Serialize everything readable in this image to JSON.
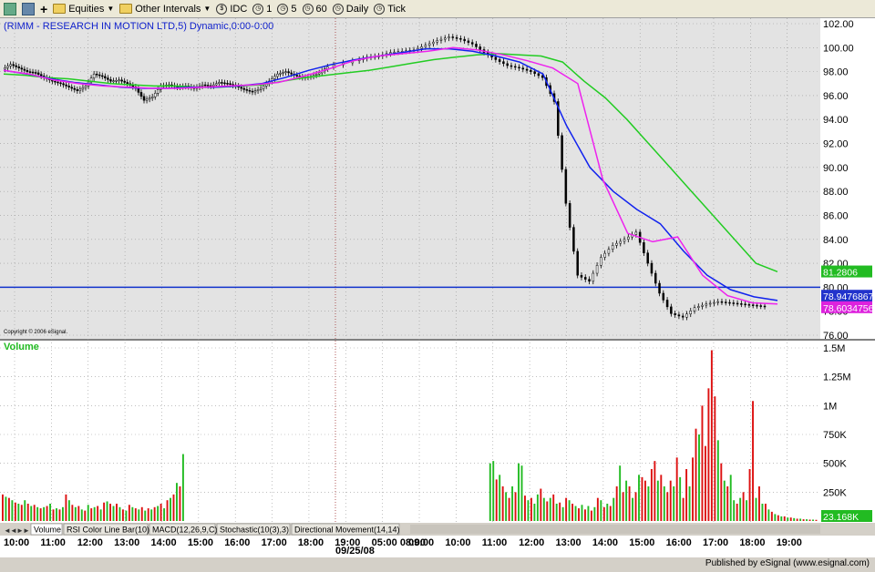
{
  "toolbar": {
    "items": [
      "Equities",
      "Other Intervals",
      "IDC",
      "1",
      "5",
      "60",
      "Daily",
      "Tick"
    ]
  },
  "chart_data": {
    "type": "candlestick",
    "title": "(RIMM - RESEARCH IN MOTION LTD,5) Dynamic,0:00-0:00",
    "copyright": "Copyright © 2006 eSignal.",
    "price_axis": {
      "ylim": [
        76,
        102
      ],
      "ticks": [
        "102.00",
        "100.00",
        "98.00",
        "96.00",
        "94.00",
        "92.00",
        "90.00",
        "88.00",
        "86.00",
        "84.00",
        "82.00",
        "80.00",
        "78.00",
        "76.00"
      ]
    },
    "time_ticks": [
      "10:00",
      "11:00",
      "12:00",
      "13:00",
      "14:00",
      "15:00",
      "16:00",
      "17:00",
      "18:00",
      "19:00",
      "05:00 08:00",
      "09:00",
      "10:00",
      "11:00",
      "12:00",
      "13:00",
      "14:00",
      "15:00",
      "16:00",
      "17:00",
      "18:00",
      "19:00"
    ],
    "date_label": "09/25/08",
    "horizontal_line": 80.0,
    "price_badges": [
      {
        "text": "81.2806",
        "color": "#22bb22"
      },
      {
        "text": "78.9476867",
        "color": "#2233cc"
      },
      {
        "text": "78.6034756",
        "color": "#dd22dd"
      }
    ],
    "price_path": [
      98.2,
      98.6,
      98.3,
      98.0,
      97.9,
      97.5,
      97.2,
      97.0,
      96.7,
      96.4,
      96.8,
      97.8,
      97.6,
      97.2,
      97.3,
      97.0,
      96.6,
      95.6,
      95.9,
      96.8,
      96.9,
      96.7,
      96.8,
      96.6,
      96.9,
      96.8,
      97.1,
      97.0,
      96.8,
      96.5,
      96.3,
      96.6,
      97.2,
      97.8,
      98.0,
      97.7,
      97.5,
      97.6,
      97.9,
      98.4,
      98.9,
      99.2,
      99.3,
      99.6,
      99.7,
      99.8,
      100.2,
      100.6,
      100.9,
      100.7,
      100.3,
      99.6,
      99.0,
      98.5,
      98.3,
      98.0,
      97.5,
      95.5,
      87.0,
      81.0,
      80.5,
      82.5,
      83.5,
      84.0,
      84.6,
      82.0,
      79.5,
      77.8,
      77.5,
      78.3,
      78.6,
      78.8,
      78.7,
      78.6,
      78.5,
      78.4
    ],
    "green_ma": [
      97.8,
      97.7,
      97.5,
      97.4,
      97.2,
      97.0,
      96.9,
      96.8,
      96.8,
      96.7,
      96.7,
      96.8,
      96.9,
      97.2,
      97.5,
      97.7,
      97.9,
      98.1,
      98.4,
      98.7,
      99.0,
      99.2,
      99.4,
      99.5,
      99.4,
      99.3,
      98.8,
      97.2,
      95.8,
      94.0,
      92.0,
      90.0,
      88.0,
      86.0,
      84.0,
      82.0,
      81.3
    ],
    "blue_ma": [
      98.1,
      97.8,
      97.4,
      97.1,
      96.9,
      96.7,
      96.6,
      96.6,
      96.7,
      96.7,
      96.8,
      97.0,
      97.5,
      98.1,
      98.6,
      99.0,
      99.3,
      99.6,
      99.9,
      99.9,
      99.7,
      99.3,
      98.8,
      97.8,
      93.5,
      90.0,
      88.0,
      86.5,
      85.3,
      83.0,
      81.0,
      79.8,
      79.2,
      78.9
    ],
    "magenta_ma": [
      98.1,
      97.8,
      97.3,
      97.0,
      96.8,
      96.7,
      96.6,
      96.6,
      96.7,
      96.8,
      96.9,
      97.1,
      97.6,
      98.2,
      98.9,
      99.3,
      99.5,
      99.7,
      100.0,
      99.8,
      99.4,
      98.9,
      98.3,
      97.0,
      89.0,
      84.5,
      83.8,
      84.2,
      81.0,
      79.3,
      78.7,
      78.6
    ],
    "volume_axis": {
      "ylim": [
        0,
        1500
      ],
      "ticks": [
        "1.5M",
        "1.25M",
        "1M",
        "750K",
        "500K",
        "250K"
      ]
    },
    "volume_label": "Volume",
    "volume_badge": "23.168K",
    "volume": [
      {
        "v": 230,
        "c": "r"
      },
      {
        "v": 210,
        "c": "g"
      },
      {
        "v": 200,
        "c": "r"
      },
      {
        "v": 180,
        "c": "g"
      },
      {
        "v": 160,
        "c": "r"
      },
      {
        "v": 150,
        "c": "g"
      },
      {
        "v": 140,
        "c": "r"
      },
      {
        "v": 180,
        "c": "g"
      },
      {
        "v": 150,
        "c": "r"
      },
      {
        "v": 130,
        "c": "g"
      },
      {
        "v": 140,
        "c": "r"
      },
      {
        "v": 120,
        "c": "g"
      },
      {
        "v": 110,
        "c": "r"
      },
      {
        "v": 120,
        "c": "g"
      },
      {
        "v": 130,
        "c": "r"
      },
      {
        "v": 150,
        "c": "g"
      },
      {
        "v": 100,
        "c": "r"
      },
      {
        "v": 110,
        "c": "g"
      },
      {
        "v": 100,
        "c": "r"
      },
      {
        "v": 120,
        "c": "g"
      },
      {
        "v": 230,
        "c": "r"
      },
      {
        "v": 180,
        "c": "g"
      },
      {
        "v": 140,
        "c": "r"
      },
      {
        "v": 120,
        "c": "g"
      },
      {
        "v": 130,
        "c": "r"
      },
      {
        "v": 100,
        "c": "g"
      },
      {
        "v": 90,
        "c": "r"
      },
      {
        "v": 140,
        "c": "g"
      },
      {
        "v": 110,
        "c": "r"
      },
      {
        "v": 120,
        "c": "g"
      },
      {
        "v": 130,
        "c": "r"
      },
      {
        "v": 100,
        "c": "g"
      },
      {
        "v": 160,
        "c": "r"
      },
      {
        "v": 170,
        "c": "g"
      },
      {
        "v": 150,
        "c": "r"
      },
      {
        "v": 130,
        "c": "g"
      },
      {
        "v": 150,
        "c": "r"
      },
      {
        "v": 120,
        "c": "g"
      },
      {
        "v": 100,
        "c": "r"
      },
      {
        "v": 90,
        "c": "g"
      },
      {
        "v": 140,
        "c": "r"
      },
      {
        "v": 120,
        "c": "g"
      },
      {
        "v": 110,
        "c": "r"
      },
      {
        "v": 100,
        "c": "g"
      },
      {
        "v": 120,
        "c": "r"
      },
      {
        "v": 90,
        "c": "g"
      },
      {
        "v": 110,
        "c": "r"
      },
      {
        "v": 100,
        "c": "g"
      },
      {
        "v": 120,
        "c": "r"
      },
      {
        "v": 130,
        "c": "g"
      },
      {
        "v": 150,
        "c": "r"
      },
      {
        "v": 110,
        "c": "g"
      },
      {
        "v": 180,
        "c": "r"
      },
      {
        "v": 200,
        "c": "g"
      },
      {
        "v": 230,
        "c": "r"
      },
      {
        "v": 330,
        "c": "g"
      },
      {
        "v": 300,
        "c": "r"
      },
      {
        "v": 580,
        "c": "g"
      },
      {
        "v": 0,
        "c": "g"
      },
      {
        "v": 0,
        "c": "g"
      },
      {
        "v": 0,
        "c": "g"
      },
      {
        "v": 0,
        "c": "g"
      },
      {
        "v": 0,
        "c": "g"
      },
      {
        "v": 0,
        "c": "g"
      },
      {
        "v": 0,
        "c": "g"
      },
      {
        "v": 0,
        "c": "g"
      },
      {
        "v": 0,
        "c": "g"
      },
      {
        "v": 0,
        "c": "g"
      },
      {
        "v": 0,
        "c": "g"
      },
      {
        "v": 0,
        "c": "g"
      },
      {
        "v": 0,
        "c": "g"
      },
      {
        "v": 0,
        "c": "g"
      },
      {
        "v": 0,
        "c": "g"
      },
      {
        "v": 0,
        "c": "g"
      },
      {
        "v": 0,
        "c": "g"
      },
      {
        "v": 0,
        "c": "g"
      },
      {
        "v": 0,
        "c": "g"
      },
      {
        "v": 0,
        "c": "g"
      },
      {
        "v": 0,
        "c": "g"
      },
      {
        "v": 0,
        "c": "g"
      },
      {
        "v": 0,
        "c": "g"
      },
      {
        "v": 0,
        "c": "g"
      },
      {
        "v": 0,
        "c": "g"
      },
      {
        "v": 0,
        "c": "g"
      },
      {
        "v": 0,
        "c": "g"
      },
      {
        "v": 0,
        "c": "g"
      },
      {
        "v": 0,
        "c": "g"
      },
      {
        "v": 0,
        "c": "g"
      },
      {
        "v": 0,
        "c": "g"
      },
      {
        "v": 0,
        "c": "g"
      },
      {
        "v": 0,
        "c": "g"
      },
      {
        "v": 0,
        "c": "g"
      },
      {
        "v": 0,
        "c": "g"
      },
      {
        "v": 0,
        "c": "g"
      },
      {
        "v": 0,
        "c": "g"
      },
      {
        "v": 0,
        "c": "g"
      },
      {
        "v": 0,
        "c": "g"
      },
      {
        "v": 0,
        "c": "g"
      },
      {
        "v": 0,
        "c": "g"
      },
      {
        "v": 0,
        "c": "g"
      },
      {
        "v": 0,
        "c": "g"
      },
      {
        "v": 0,
        "c": "g"
      },
      {
        "v": 0,
        "c": "g"
      },
      {
        "v": 0,
        "c": "g"
      },
      {
        "v": 0,
        "c": "g"
      },
      {
        "v": 0,
        "c": "g"
      },
      {
        "v": 0,
        "c": "g"
      },
      {
        "v": 0,
        "c": "g"
      },
      {
        "v": 0,
        "c": "g"
      },
      {
        "v": 0,
        "c": "g"
      },
      {
        "v": 0,
        "c": "g"
      },
      {
        "v": 0,
        "c": "g"
      },
      {
        "v": 0,
        "c": "g"
      },
      {
        "v": 0,
        "c": "g"
      },
      {
        "v": 0,
        "c": "g"
      },
      {
        "v": 0,
        "c": "g"
      },
      {
        "v": 0,
        "c": "g"
      },
      {
        "v": 0,
        "c": "g"
      },
      {
        "v": 0,
        "c": "g"
      },
      {
        "v": 0,
        "c": "g"
      },
      {
        "v": 0,
        "c": "g"
      },
      {
        "v": 0,
        "c": "g"
      },
      {
        "v": 0,
        "c": "g"
      },
      {
        "v": 0,
        "c": "g"
      },
      {
        "v": 0,
        "c": "g"
      },
      {
        "v": 0,
        "c": "g"
      },
      {
        "v": 0,
        "c": "g"
      },
      {
        "v": 0,
        "c": "g"
      },
      {
        "v": 0,
        "c": "g"
      },
      {
        "v": 0,
        "c": "g"
      },
      {
        "v": 0,
        "c": "g"
      },
      {
        "v": 0,
        "c": "g"
      },
      {
        "v": 0,
        "c": "g"
      },
      {
        "v": 0,
        "c": "g"
      },
      {
        "v": 0,
        "c": "g"
      },
      {
        "v": 0,
        "c": "g"
      },
      {
        "v": 0,
        "c": "g"
      },
      {
        "v": 0,
        "c": "g"
      },
      {
        "v": 0,
        "c": "g"
      },
      {
        "v": 0,
        "c": "g"
      },
      {
        "v": 0,
        "c": "g"
      },
      {
        "v": 0,
        "c": "g"
      },
      {
        "v": 0,
        "c": "g"
      },
      {
        "v": 0,
        "c": "g"
      },
      {
        "v": 0,
        "c": "g"
      },
      {
        "v": 0,
        "c": "g"
      },
      {
        "v": 0,
        "c": "g"
      },
      {
        "v": 0,
        "c": "g"
      },
      {
        "v": 0,
        "c": "g"
      },
      {
        "v": 0,
        "c": "g"
      },
      {
        "v": 0,
        "c": "g"
      },
      {
        "v": 0,
        "c": "g"
      },
      {
        "v": 0,
        "c": "g"
      },
      {
        "v": 0,
        "c": "g"
      },
      {
        "v": 500,
        "c": "g"
      },
      {
        "v": 520,
        "c": "g"
      },
      {
        "v": 360,
        "c": "r"
      },
      {
        "v": 400,
        "c": "g"
      },
      {
        "v": 300,
        "c": "r"
      },
      {
        "v": 250,
        "c": "g"
      },
      {
        "v": 200,
        "c": "r"
      },
      {
        "v": 300,
        "c": "g"
      },
      {
        "v": 250,
        "c": "r"
      },
      {
        "v": 500,
        "c": "g"
      },
      {
        "v": 480,
        "c": "g"
      },
      {
        "v": 220,
        "c": "r"
      },
      {
        "v": 180,
        "c": "g"
      },
      {
        "v": 200,
        "c": "r"
      },
      {
        "v": 150,
        "c": "g"
      },
      {
        "v": 230,
        "c": "g"
      },
      {
        "v": 280,
        "c": "r"
      },
      {
        "v": 200,
        "c": "g"
      },
      {
        "v": 170,
        "c": "r"
      },
      {
        "v": 200,
        "c": "g"
      },
      {
        "v": 230,
        "c": "r"
      },
      {
        "v": 150,
        "c": "g"
      },
      {
        "v": 160,
        "c": "r"
      },
      {
        "v": 120,
        "c": "g"
      },
      {
        "v": 200,
        "c": "r"
      },
      {
        "v": 180,
        "c": "g"
      },
      {
        "v": 150,
        "c": "r"
      },
      {
        "v": 130,
        "c": "g"
      },
      {
        "v": 110,
        "c": "r"
      },
      {
        "v": 140,
        "c": "g"
      },
      {
        "v": 100,
        "c": "r"
      },
      {
        "v": 130,
        "c": "g"
      },
      {
        "v": 90,
        "c": "r"
      },
      {
        "v": 120,
        "c": "g"
      },
      {
        "v": 200,
        "c": "r"
      },
      {
        "v": 180,
        "c": "g"
      },
      {
        "v": 120,
        "c": "r"
      },
      {
        "v": 150,
        "c": "g"
      },
      {
        "v": 130,
        "c": "r"
      },
      {
        "v": 200,
        "c": "g"
      },
      {
        "v": 300,
        "c": "r"
      },
      {
        "v": 480,
        "c": "g"
      },
      {
        "v": 250,
        "c": "r"
      },
      {
        "v": 350,
        "c": "g"
      },
      {
        "v": 300,
        "c": "r"
      },
      {
        "v": 200,
        "c": "g"
      },
      {
        "v": 250,
        "c": "r"
      },
      {
        "v": 400,
        "c": "g"
      },
      {
        "v": 380,
        "c": "r"
      },
      {
        "v": 350,
        "c": "r"
      },
      {
        "v": 300,
        "c": "g"
      },
      {
        "v": 450,
        "c": "r"
      },
      {
        "v": 520,
        "c": "r"
      },
      {
        "v": 350,
        "c": "g"
      },
      {
        "v": 400,
        "c": "r"
      },
      {
        "v": 300,
        "c": "g"
      },
      {
        "v": 250,
        "c": "r"
      },
      {
        "v": 350,
        "c": "r"
      },
      {
        "v": 300,
        "c": "g"
      },
      {
        "v": 550,
        "c": "r"
      },
      {
        "v": 380,
        "c": "g"
      },
      {
        "v": 200,
        "c": "r"
      },
      {
        "v": 450,
        "c": "r"
      },
      {
        "v": 300,
        "c": "g"
      },
      {
        "v": 550,
        "c": "r"
      },
      {
        "v": 800,
        "c": "r"
      },
      {
        "v": 750,
        "c": "g"
      },
      {
        "v": 1000,
        "c": "r"
      },
      {
        "v": 650,
        "c": "r"
      },
      {
        "v": 1150,
        "c": "r"
      },
      {
        "v": 1480,
        "c": "r"
      },
      {
        "v": 1080,
        "c": "r"
      },
      {
        "v": 700,
        "c": "g"
      },
      {
        "v": 500,
        "c": "r"
      },
      {
        "v": 350,
        "c": "g"
      },
      {
        "v": 300,
        "c": "r"
      },
      {
        "v": 400,
        "c": "g"
      },
      {
        "v": 180,
        "c": "g"
      },
      {
        "v": 150,
        "c": "r"
      },
      {
        "v": 200,
        "c": "g"
      },
      {
        "v": 250,
        "c": "r"
      },
      {
        "v": 180,
        "c": "g"
      },
      {
        "v": 450,
        "c": "r"
      },
      {
        "v": 1040,
        "c": "r"
      },
      {
        "v": 200,
        "c": "g"
      },
      {
        "v": 300,
        "c": "r"
      },
      {
        "v": 150,
        "c": "g"
      },
      {
        "v": 150,
        "c": "r"
      },
      {
        "v": 100,
        "c": "g"
      },
      {
        "v": 80,
        "c": "r"
      },
      {
        "v": 60,
        "c": "g"
      },
      {
        "v": 50,
        "c": "r"
      },
      {
        "v": 40,
        "c": "g"
      },
      {
        "v": 40,
        "c": "r"
      },
      {
        "v": 30,
        "c": "g"
      },
      {
        "v": 30,
        "c": "r"
      },
      {
        "v": 25,
        "c": "g"
      },
      {
        "v": 20,
        "c": "r"
      },
      {
        "v": 20,
        "c": "g"
      },
      {
        "v": 15,
        "c": "r"
      },
      {
        "v": 15,
        "c": "g"
      },
      {
        "v": 12,
        "c": "r"
      },
      {
        "v": 12,
        "c": "g"
      },
      {
        "v": 10,
        "c": "r"
      }
    ],
    "tabs": [
      "Volume",
      "RSI Color Line Bar(10)",
      "MACD(12,26,9,C)",
      "Stochastic(10(3),3)",
      "Directional Movement(14,14)"
    ]
  },
  "footer": {
    "published": "Published by eSignal (www.esignal.com)"
  },
  "colors": {
    "up": "#22bb22",
    "down": "#dd1111",
    "blue_ma": "#1122ee",
    "magenta_ma": "#ee22ee",
    "green_ma": "#22cc22",
    "hline": "#1133cc"
  }
}
